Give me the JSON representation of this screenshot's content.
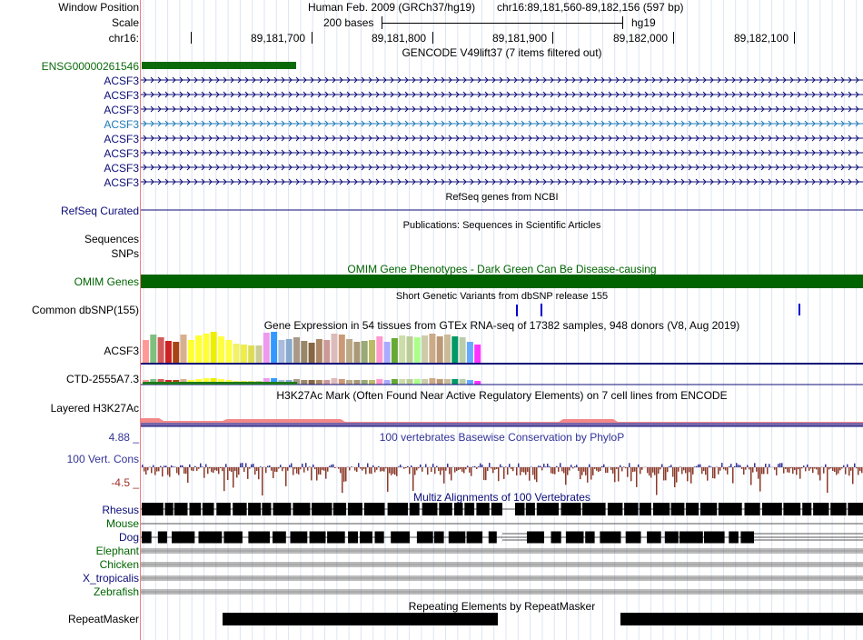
{
  "header": {
    "window_position_label": "Window Position",
    "scale_label": "Scale",
    "chrom_label": "chr16:",
    "assembly": "Human Feb. 2009 (GRCh37/hg19)",
    "position": "chr16:89,181,560-89,182,156 (597 bp)",
    "scale_text": "200 bases",
    "db": "hg19",
    "ruler_ticks": [
      "89,181,700",
      "89,181,800",
      "89,181,900",
      "89,182,000",
      "89,182,100"
    ]
  },
  "gencode": {
    "title": "GENCODE V49lift37 (7 items filtered out)",
    "items": [
      "ENSG00000261546",
      "ACSF3",
      "ACSF3",
      "ACSF3",
      "ACSF3",
      "ACSF3",
      "ACSF3",
      "ACSF3",
      "ACSF3"
    ]
  },
  "refseq": {
    "title": "RefSeq genes from NCBI",
    "label": "RefSeq Curated"
  },
  "publications": {
    "title": "Publications: Sequences in Scientific Articles",
    "labels": [
      "Sequences",
      "SNPs"
    ]
  },
  "omim": {
    "title": "OMIM Gene Phenotypes - Dark Green Can Be Disease-causing",
    "label": "OMIM Genes"
  },
  "dbsnp": {
    "title": "Short Genetic Variants from dbSNP release 155",
    "label": "Common dbSNP(155)"
  },
  "gtex": {
    "title": "Gene Expression in 54 tissues from GTEx RNA-seq of 17382 samples, 948 donors (V8, Aug 2019)",
    "labels": [
      "ACSF3",
      "CTD-2555A7.3"
    ]
  },
  "h3k27ac": {
    "title": "H3K27Ac Mark (Often Found Near Active Regulatory Elements) on 7 cell lines from ENCODE",
    "label": "Layered H3K27Ac"
  },
  "phylop": {
    "title": "100 vertebrates Basewise Conservation by PhyloP",
    "label": "100 Vert. Cons",
    "max": "4.88 _",
    "min": "-4.5 _"
  },
  "multiz": {
    "title": "Multiz Alignments of 100 Vertebrates",
    "species": [
      "Rhesus",
      "Mouse",
      "Dog",
      "Elephant",
      "Chicken",
      "X_tropicalis",
      "Zebrafish"
    ]
  },
  "repeatmasker": {
    "title": "Repeating Elements by RepeatMasker",
    "label": "RepeatMasker"
  },
  "colors": {
    "navy": "#0c0c78",
    "dark_green": "#006400",
    "gencode_green": "#0a6a0a",
    "acsf3_blue": "#0c0c78",
    "acsf3_cyan": "#1e7ab8",
    "red_sep": "#f08080"
  }
}
